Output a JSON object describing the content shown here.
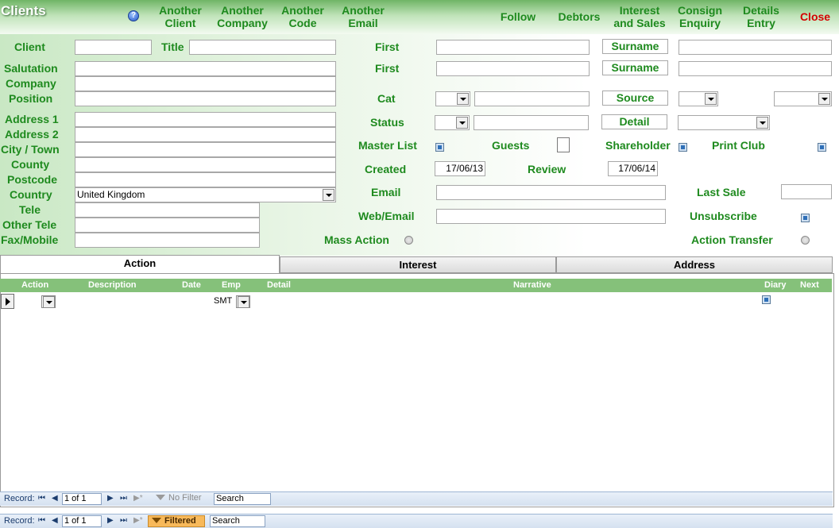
{
  "header": {
    "title": "Clients",
    "buttons": {
      "another_client": "Another\nClient",
      "another_company": "Another\nCompany",
      "another_code": "Another\nCode",
      "another_email": "Another\nEmail",
      "follow": "Follow",
      "debtors": "Debtors",
      "interest_sales": "Interest\nand Sales",
      "consign_enquiry": "Consign\nEnquiry",
      "details_entry": "Details\nEntry",
      "close": "Close"
    }
  },
  "labels": {
    "client": "Client",
    "title": "Title",
    "salutation": "Salutation",
    "company": "Company",
    "position": "Position",
    "address1": "Address 1",
    "address2": "Address 2",
    "city": "City / Town",
    "county": "County",
    "postcode": "Postcode",
    "country": "Country",
    "tele": "Tele",
    "other_tele": "Other Tele",
    "fax_mobile": "Fax/Mobile",
    "first1": "First",
    "first2": "First",
    "surname1": "Surname",
    "surname2": "Surname",
    "cat": "Cat",
    "source": "Source",
    "status": "Status",
    "detail": "Detail",
    "master_list": "Master List",
    "guests": "Guests",
    "shareholder": "Shareholder",
    "print_club": "Print Club",
    "created": "Created",
    "review": "Review",
    "email": "Email",
    "last_sale": "Last Sale",
    "web_email": "Web/Email",
    "unsubscribe": "Unsubscribe",
    "mass_action": "Mass Action",
    "action_transfer": "Action Transfer"
  },
  "values": {
    "country": "United Kingdom",
    "created": "17/06/13",
    "review": "17/06/14"
  },
  "tabs": [
    "Action",
    "Interest",
    "Address"
  ],
  "grid": {
    "columns": [
      "Action",
      "Description",
      "Date",
      "Emp",
      "Detail",
      "Narrative",
      "Diary",
      "Next"
    ],
    "row": {
      "emp": "SMT"
    }
  },
  "subnav": {
    "record_label": "Record:",
    "position": "1 of 1",
    "filter": "No Filter",
    "search": "Search"
  },
  "mainnav": {
    "record_label": "Record:",
    "position": "1 of 1",
    "filter": "Filtered",
    "search": "Search"
  },
  "colors": {
    "label_green": "#1e8a1e",
    "close_red": "#d40000",
    "grid_header": "#85c17a"
  }
}
